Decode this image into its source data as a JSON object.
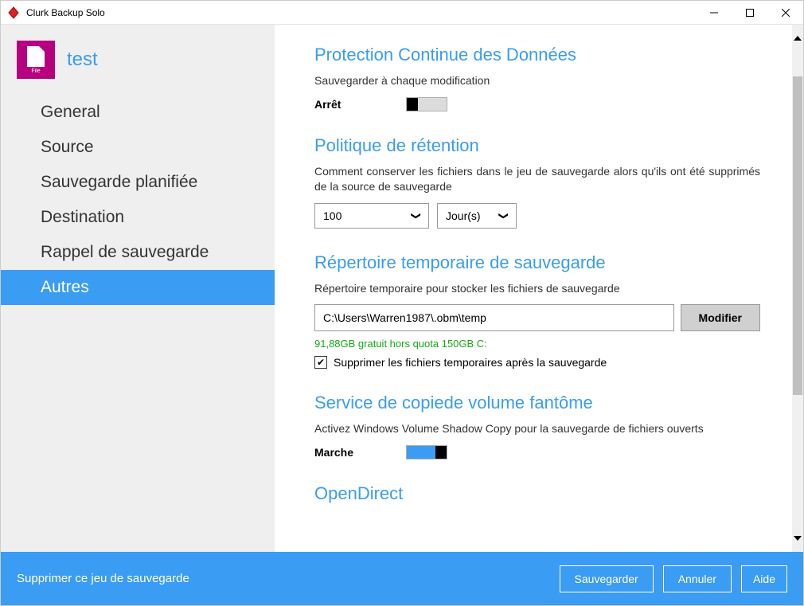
{
  "window": {
    "title": "Clurk Backup Solo"
  },
  "sidebar": {
    "icon_label": "File",
    "profile_name": "test",
    "nav": [
      {
        "label": "General"
      },
      {
        "label": "Source"
      },
      {
        "label": "Sauvegarde planifiée"
      },
      {
        "label": "Destination"
      },
      {
        "label": "Rappel de sauvegarde"
      },
      {
        "label": "Autres"
      }
    ]
  },
  "sections": {
    "cdp": {
      "title": "Protection Continue des Données",
      "desc": "Sauvegarder à chaque modification",
      "toggle_label": "Arrêt",
      "toggle_state": "off"
    },
    "retention": {
      "title": "Politique de rétention",
      "desc": "Comment conserver les fichiers dans le jeu de sauvegarde alors qu'ils ont été supprimés de la source de sauvegarde",
      "count": "100",
      "unit": "Jour(s)"
    },
    "tempdir": {
      "title": "Répertoire temporaire de sauvegarde",
      "desc": "Répertoire temporaire pour stocker les fichiers de sauvegarde",
      "path": "C:\\Users\\Warren1987\\.obm\\temp",
      "modify_btn": "Modifier",
      "free_space": "91,88GB gratuit hors quota 150GB C:",
      "checkbox_label": "Supprimer les fichiers temporaires après la sauvegarde",
      "checkbox_checked": true
    },
    "vss": {
      "title": "Service de copiede volume fantôme",
      "desc": "Activez Windows Volume Shadow Copy pour la sauvegarde de fichiers ouverts",
      "toggle_label": "Marche",
      "toggle_state": "on"
    },
    "opendirect": {
      "title": "OpenDirect"
    }
  },
  "footer": {
    "delete_link": "Supprimer ce jeu de sauvegarde",
    "save": "Sauvegarder",
    "cancel": "Annuler",
    "help": "Aide"
  }
}
